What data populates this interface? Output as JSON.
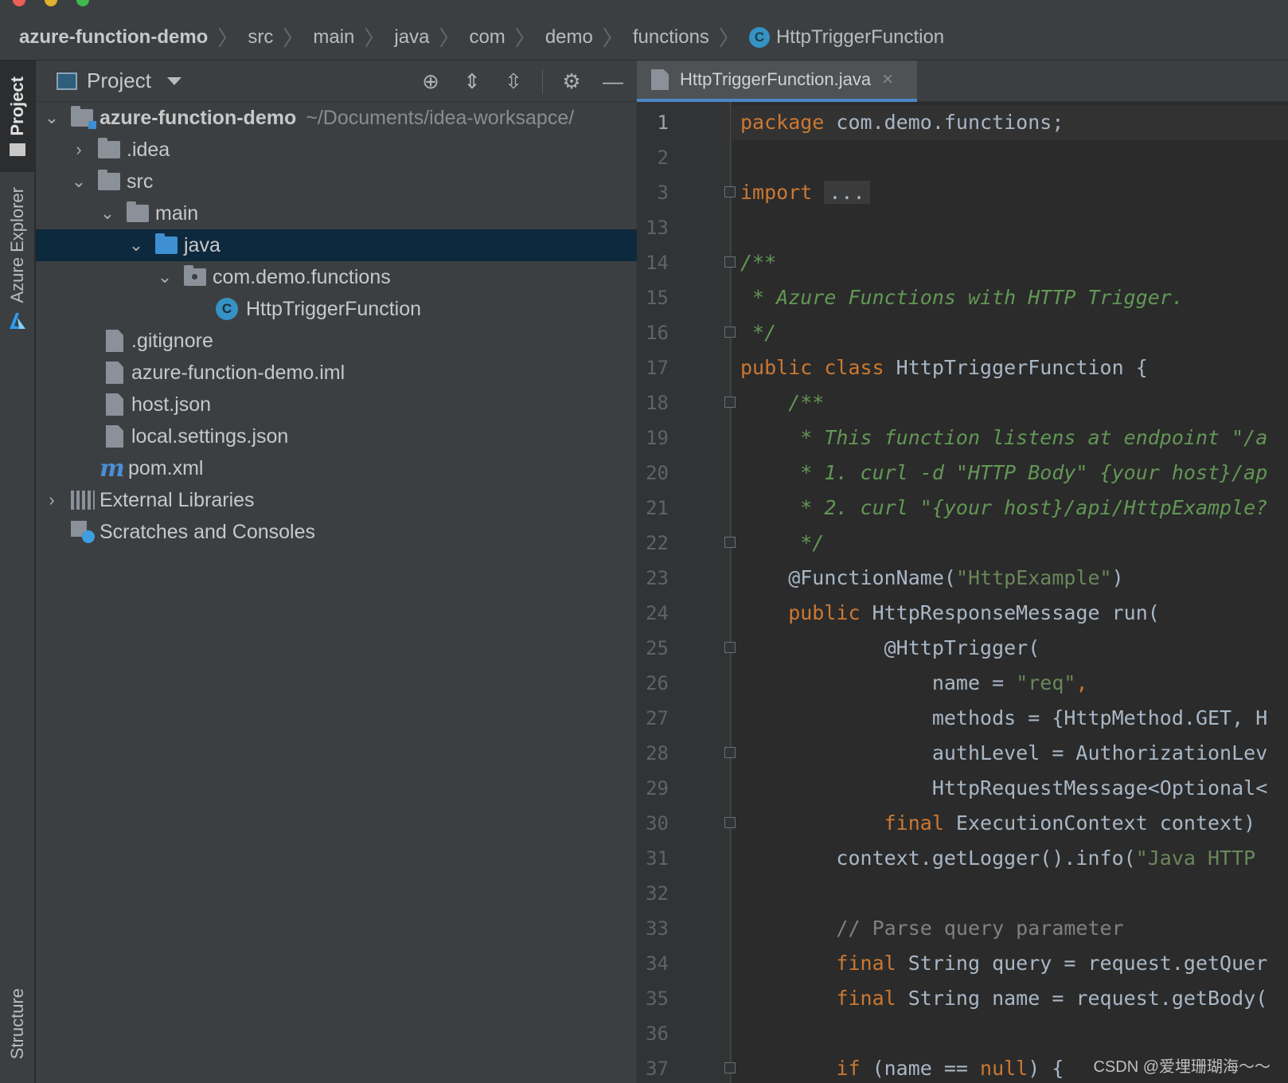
{
  "breadcrumb": {
    "items": [
      "azure-function-demo",
      "src",
      "main",
      "java",
      "com",
      "demo",
      "functions"
    ],
    "current": "HttpTriggerFunction"
  },
  "left_strip": {
    "project_label": "Project",
    "azure_label": "Azure Explorer",
    "structure_label": "Structure"
  },
  "project_panel": {
    "title": "Project",
    "tree": [
      {
        "label": "azure-function-demo",
        "hint": "~/Documents/idea-worksapce/"
      },
      {
        "label": ".idea"
      },
      {
        "label": "src"
      },
      {
        "label": "main"
      },
      {
        "label": "java"
      },
      {
        "label": "com.demo.functions"
      },
      {
        "label": "HttpTriggerFunction"
      },
      {
        "label": ".gitignore"
      },
      {
        "label": "azure-function-demo.iml"
      },
      {
        "label": "host.json"
      },
      {
        "label": "local.settings.json"
      },
      {
        "label": "pom.xml"
      },
      {
        "label": "External Libraries"
      },
      {
        "label": "Scratches and Consoles"
      }
    ]
  },
  "editor": {
    "tab_label": "HttpTriggerFunction.java",
    "line_numbers": [
      "1",
      "2",
      "3",
      "13",
      "14",
      "15",
      "16",
      "17",
      "18",
      "19",
      "20",
      "21",
      "22",
      "23",
      "24",
      "25",
      "26",
      "27",
      "28",
      "29",
      "30",
      "31",
      "32",
      "33",
      "34",
      "35",
      "36",
      "37"
    ],
    "lines": {
      "l1_kw": "package",
      "l1_rest": " com.demo.functions;",
      "l3_kw": "import",
      "l3_fold": "...",
      "l14": "/**",
      "l15": " * Azure Functions with HTTP Trigger.",
      "l16": " */",
      "l17_kw": "public class",
      "l17_rest": " HttpTriggerFunction {",
      "l18": "    /**",
      "l19": "     * This function listens at endpoint \"/a",
      "l20": "     * 1. curl -d \"HTTP Body\" {your host}/ap",
      "l21": "     * 2. curl \"{your host}/api/HttpExample?",
      "l22": "     */",
      "l23_ann": "    @FunctionName(",
      "l23_str": "\"HttpExample\"",
      "l23_end": ")",
      "l24_kw": "    public",
      "l24_rest": " HttpResponseMessage run(",
      "l25": "            @HttpTrigger(",
      "l26_a": "                name = ",
      "l26_str": "\"req\"",
      "l26_end": ",",
      "l27_a": "                methods = {HttpMethod.GET",
      "l27_b": ", H",
      "l28": "                authLevel = AuthorizationLev",
      "l29": "                HttpRequestMessage<Optional<",
      "l30_kw": "            final",
      "l30_rest": " ExecutionContext context)",
      "l31_a": "        context.getLogger().info(",
      "l31_str": "\"Java HTTP ",
      "l33": "        // Parse query parameter",
      "l34_kw": "        final",
      "l34_rest": " String query = request.getQuer",
      "l35_kw": "        final",
      "l35_rest": " String name = request.getBody(",
      "l37_kw": "        if",
      "l37_a": " (name == ",
      "l37_kw2": "null",
      "l37_b": ") {"
    }
  },
  "watermark": "CSDN @爱埋珊瑚海～～",
  "colors": {
    "keyword": "#cc7832",
    "string": "#6a8759",
    "doc_comment": "#629755",
    "comment": "#808080",
    "annotation": "#bbb529",
    "selection": "#0d293e"
  }
}
